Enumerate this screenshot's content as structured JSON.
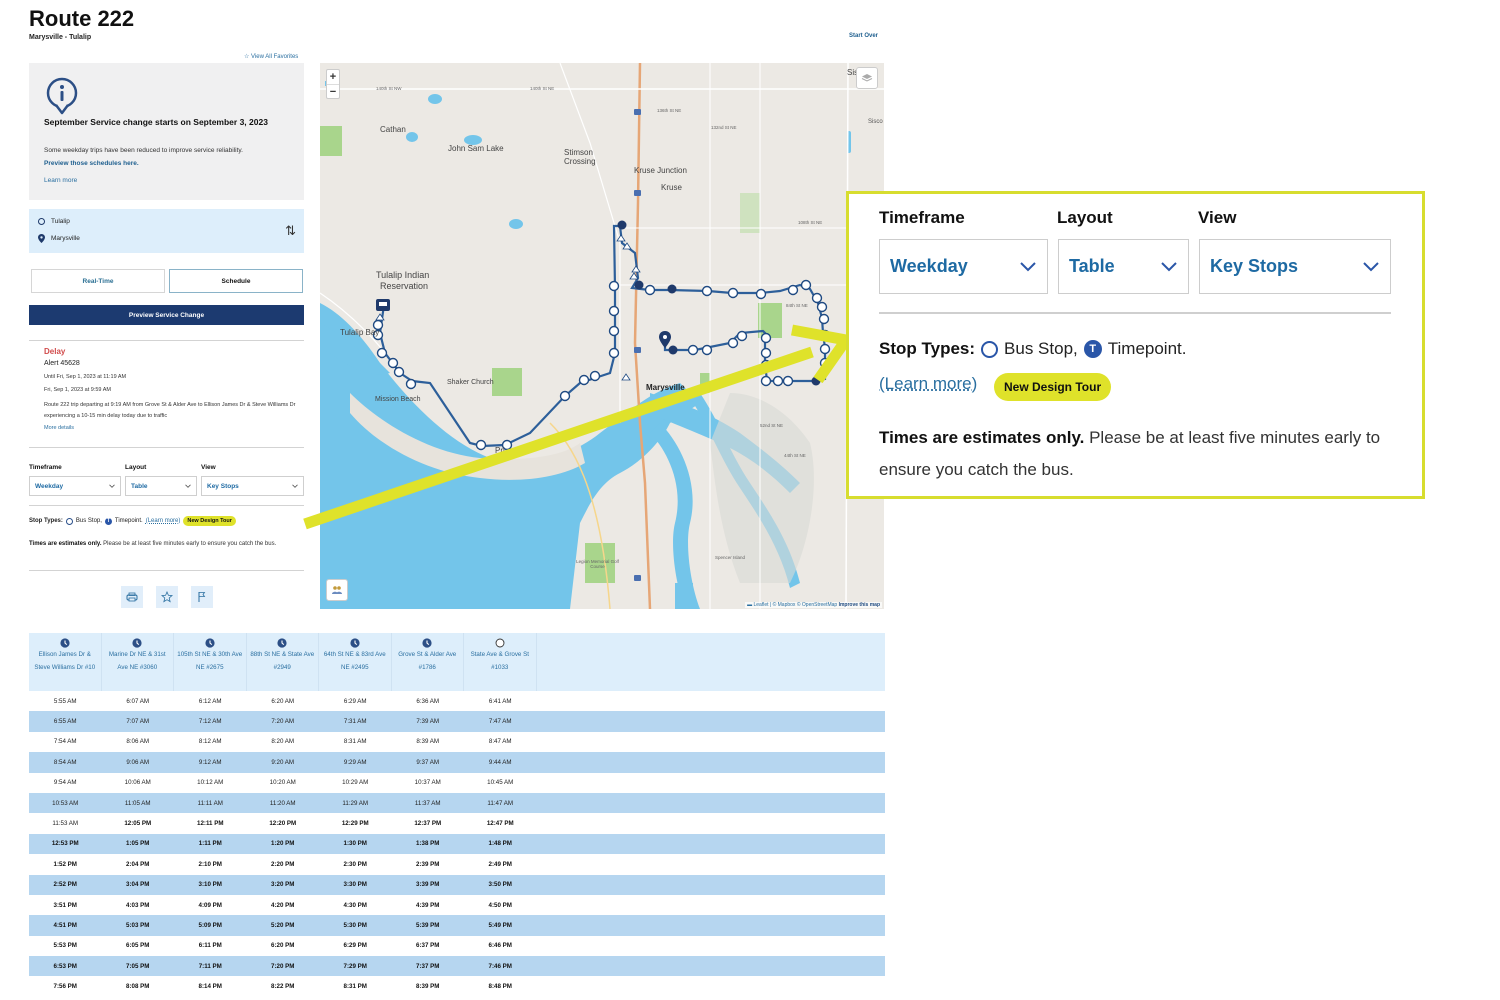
{
  "header": {
    "title": "Route 222",
    "subtitle": "Marysville - Tulalip",
    "start_over": "Start Over",
    "view_favorites": "☆ View All Favorites"
  },
  "notice": {
    "icon": "info-pin-icon",
    "title": "September Service change starts on September 3, 2023",
    "body": "Some weekday trips have been reduced to improve service reliability.",
    "link": "Preview those schedules here.",
    "learn_more": "Learn more"
  },
  "endpoints": {
    "origin": "Tulalip",
    "destination": "Marysville",
    "swap_icon": "⇅"
  },
  "tabs": [
    {
      "label": "Real-Time",
      "active": false
    },
    {
      "label": "Schedule",
      "active": true
    }
  ],
  "preview_button": "Preview Service Change",
  "alert": {
    "type": "Delay",
    "number": "Alert 45628",
    "until": "Until Fri, Sep 1, 2023 at 11:19 AM",
    "posted": "Fri, Sep 1, 2023 at 9:59 AM",
    "description": "Route 222 trip departing at 9:19 AM from Grove St & Alder Ave to Ellison James Dr & Steve Williams Dr experiencing a 10-15 min delay today due to traffic",
    "more_details": "More details"
  },
  "selectors": {
    "timeframe": {
      "label": "Timeframe",
      "value": "Weekday"
    },
    "layout": {
      "label": "Layout",
      "value": "Table"
    },
    "view": {
      "label": "View",
      "value": "Key Stops"
    }
  },
  "legend": {
    "prefix": "Stop Types:",
    "bus_stop": "Bus Stop,",
    "timepoint": "Timepoint.",
    "learn_more": "(Learn more)",
    "tour": "New Design Tour"
  },
  "estimates": {
    "bold": "Times are estimates only.",
    "rest": " Please be at least five minutes early to ensure you catch the bus."
  },
  "actions": [
    {
      "icon": "print-icon"
    },
    {
      "icon": "star-icon"
    },
    {
      "icon": "flag-icon"
    }
  ],
  "map": {
    "zoom_in": "+",
    "zoom_out": "−",
    "attribution": "▬ Leaflet | © Mapbox © OpenStreetMap",
    "improve": "Improve this map",
    "labels": {
      "sisco": "Sisco",
      "sisco2": "Sisco",
      "cathan": "Cathan",
      "john_sam_lake": "John Sam Lake",
      "stimson": "Stimson",
      "crossing": "Crossing",
      "kruse_junction": "Kruse Junction",
      "kruse": "Kruse",
      "tulalip1": "Tulalip Indian",
      "tulalip2": "Reservation",
      "tulalip_bay": "Tulalip Bay",
      "mission_beach": "Mission Beach",
      "shaker_church": "Shaker Church",
      "marysville": "Marysville",
      "priest_point": "Pri",
      "st140nw": "140th St NW",
      "st140ne": "140th St NE",
      "st136ne": "136th St NE",
      "st132ne": "132nd St NE",
      "st108ne": "108th St NE",
      "st84ne": "84th St NE",
      "st52ne": "52nd St NE",
      "st44ne": "44th St NE",
      "legion": "Legion Memorial Golf Course",
      "spencer": "Spencer Island"
    }
  },
  "schedule": {
    "stops": [
      {
        "name": "Ellison James Dr & Steve Williams Dr #10",
        "type": "timepoint"
      },
      {
        "name": "Marine Dr NE & 31st Ave NE #3060",
        "type": "timepoint"
      },
      {
        "name": "105th St NE & 30th Ave NE #2675",
        "type": "timepoint"
      },
      {
        "name": "88th St NE & State Ave #2949",
        "type": "timepoint"
      },
      {
        "name": "64th St NE & 83rd Ave NE #2495",
        "type": "timepoint"
      },
      {
        "name": "Grove St & Alder Ave #1786",
        "type": "timepoint"
      },
      {
        "name": "State Ave & Grove St #1033",
        "type": "bus-stop"
      }
    ],
    "rows": [
      [
        "5:55 AM",
        "6:07 AM",
        "6:12 AM",
        "6:20 AM",
        "6:29 AM",
        "6:36 AM",
        "6:41 AM"
      ],
      [
        "6:55 AM",
        "7:07 AM",
        "7:12 AM",
        "7:20 AM",
        "7:31 AM",
        "7:39 AM",
        "7:47 AM"
      ],
      [
        "7:54 AM",
        "8:06 AM",
        "8:12 AM",
        "8:20 AM",
        "8:31 AM",
        "8:39 AM",
        "8:47 AM"
      ],
      [
        "8:54 AM",
        "9:06 AM",
        "9:12 AM",
        "9:20 AM",
        "9:29 AM",
        "9:37 AM",
        "9:44 AM"
      ],
      [
        "9:54 AM",
        "10:06 AM",
        "10:12 AM",
        "10:20 AM",
        "10:29 AM",
        "10:37 AM",
        "10:45 AM"
      ],
      [
        "10:53 AM",
        "11:05 AM",
        "11:11 AM",
        "11:20 AM",
        "11:29 AM",
        "11:37 AM",
        "11:47 AM"
      ],
      [
        "11:53 AM",
        "12:05 PM",
        "12:11 PM",
        "12:20 PM",
        "12:29 PM",
        "12:37 PM",
        "12:47 PM"
      ],
      [
        "12:53 PM",
        "1:05 PM",
        "1:11 PM",
        "1:20 PM",
        "1:30 PM",
        "1:38 PM",
        "1:48 PM"
      ],
      [
        "1:52 PM",
        "2:04 PM",
        "2:10 PM",
        "2:20 PM",
        "2:30 PM",
        "2:39 PM",
        "2:49 PM"
      ],
      [
        "2:52 PM",
        "3:04 PM",
        "3:10 PM",
        "3:20 PM",
        "3:30 PM",
        "3:39 PM",
        "3:50 PM"
      ],
      [
        "3:51 PM",
        "4:03 PM",
        "4:09 PM",
        "4:20 PM",
        "4:30 PM",
        "4:39 PM",
        "4:50 PM"
      ],
      [
        "4:51 PM",
        "5:03 PM",
        "5:09 PM",
        "5:20 PM",
        "5:30 PM",
        "5:39 PM",
        "5:49 PM"
      ],
      [
        "5:53 PM",
        "6:05 PM",
        "6:11 PM",
        "6:20 PM",
        "6:29 PM",
        "6:37 PM",
        "6:46 PM"
      ],
      [
        "6:53 PM",
        "7:05 PM",
        "7:11 PM",
        "7:20 PM",
        "7:29 PM",
        "7:37 PM",
        "7:46 PM"
      ],
      [
        "7:56 PM",
        "8:08 PM",
        "8:14 PM",
        "8:22 PM",
        "8:31 PM",
        "8:39 PM",
        "8:48 PM"
      ]
    ]
  },
  "callout": {
    "timeframe_label": "Timeframe",
    "layout_label": "Layout",
    "view_label": "View",
    "timeframe_value": "Weekday",
    "layout_value": "Table",
    "view_value": "Key Stops",
    "stop_types": "Stop Types:",
    "bus_stop": "Bus Stop,",
    "timepoint": "Timepoint.",
    "learn_more": "(Learn more)",
    "tour": "New Design Tour",
    "est_bold": "Times are estimates only.",
    "est_rest": " Please be at least five minutes early to ensure you catch the bus."
  },
  "colors": {
    "navy": "#1c3a70",
    "link": "#2a6fa0",
    "highlight": "#dfe22a",
    "alt_row": "#b6d6f0",
    "header_bg": "#ddeefb",
    "route": "#2d5f9a",
    "alert_red": "#d14b4b"
  }
}
